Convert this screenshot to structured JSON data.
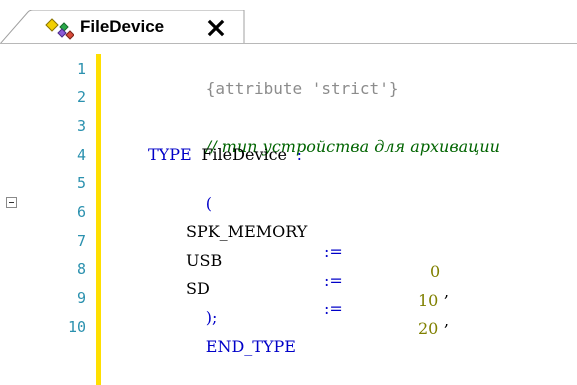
{
  "tab": {
    "title": "FileDevice",
    "close_glyph": "✕",
    "icon": "datatype-icon"
  },
  "editor": {
    "line_numbers": [
      "1",
      "2",
      "3",
      "4",
      "5",
      "6",
      "7",
      "8",
      "9",
      "10"
    ],
    "lines": {
      "l1": "{attribute 'strict'}",
      "l3": "// тип устройства для архивации",
      "l4_kw": "TYPE",
      "l4_name": "FileDevice",
      "l4_colon": ":",
      "l5": "(",
      "l6_name": "SPK_MEMORY",
      "l6_op": ":=",
      "l6_val": "0",
      "l6_sep": ",",
      "l7_name": "USB",
      "l7_op": ":=",
      "l7_val": "10",
      "l7_sep": ",",
      "l8_name": "SD",
      "l8_op": ":=",
      "l8_val": "20",
      "l9": ");",
      "l10": "END_TYPE"
    },
    "colors": {
      "line_number": "#2b91af",
      "keyword": "#0000c8",
      "comment": "#006400",
      "attribute": "#8c8c8c",
      "number": "#808000",
      "change_marker": "#ffdf00"
    }
  }
}
